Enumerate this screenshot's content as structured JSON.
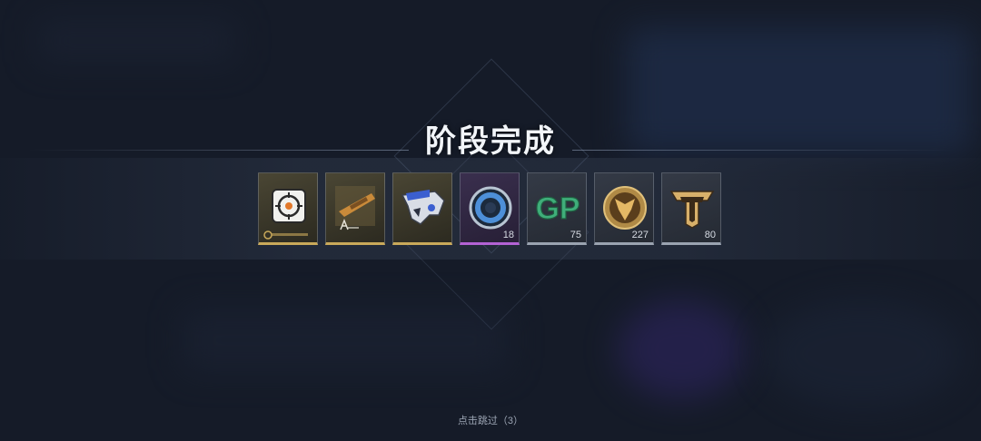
{
  "title": "阶段完成",
  "skip_hint": "点击跳过（3）",
  "rewards": [
    {
      "icon": "target-upgrade-icon",
      "rarity": "gold",
      "quantity": ""
    },
    {
      "icon": "weapon-blueprint-icon",
      "rarity": "gold",
      "quantity": ""
    },
    {
      "icon": "weapon-skin-icon",
      "rarity": "gold",
      "quantity": ""
    },
    {
      "icon": "blue-token-icon",
      "rarity": "purple",
      "quantity": "18"
    },
    {
      "icon": "gp-currency-icon",
      "rarity": "grey",
      "quantity": "75"
    },
    {
      "icon": "gold-medal-icon",
      "rarity": "grey",
      "quantity": "227"
    },
    {
      "icon": "tt-emblem-icon",
      "rarity": "grey",
      "quantity": "80"
    }
  ],
  "colors": {
    "gold": "#c9a95a",
    "purple": "#b362d4",
    "grey": "#9aa3b0"
  }
}
